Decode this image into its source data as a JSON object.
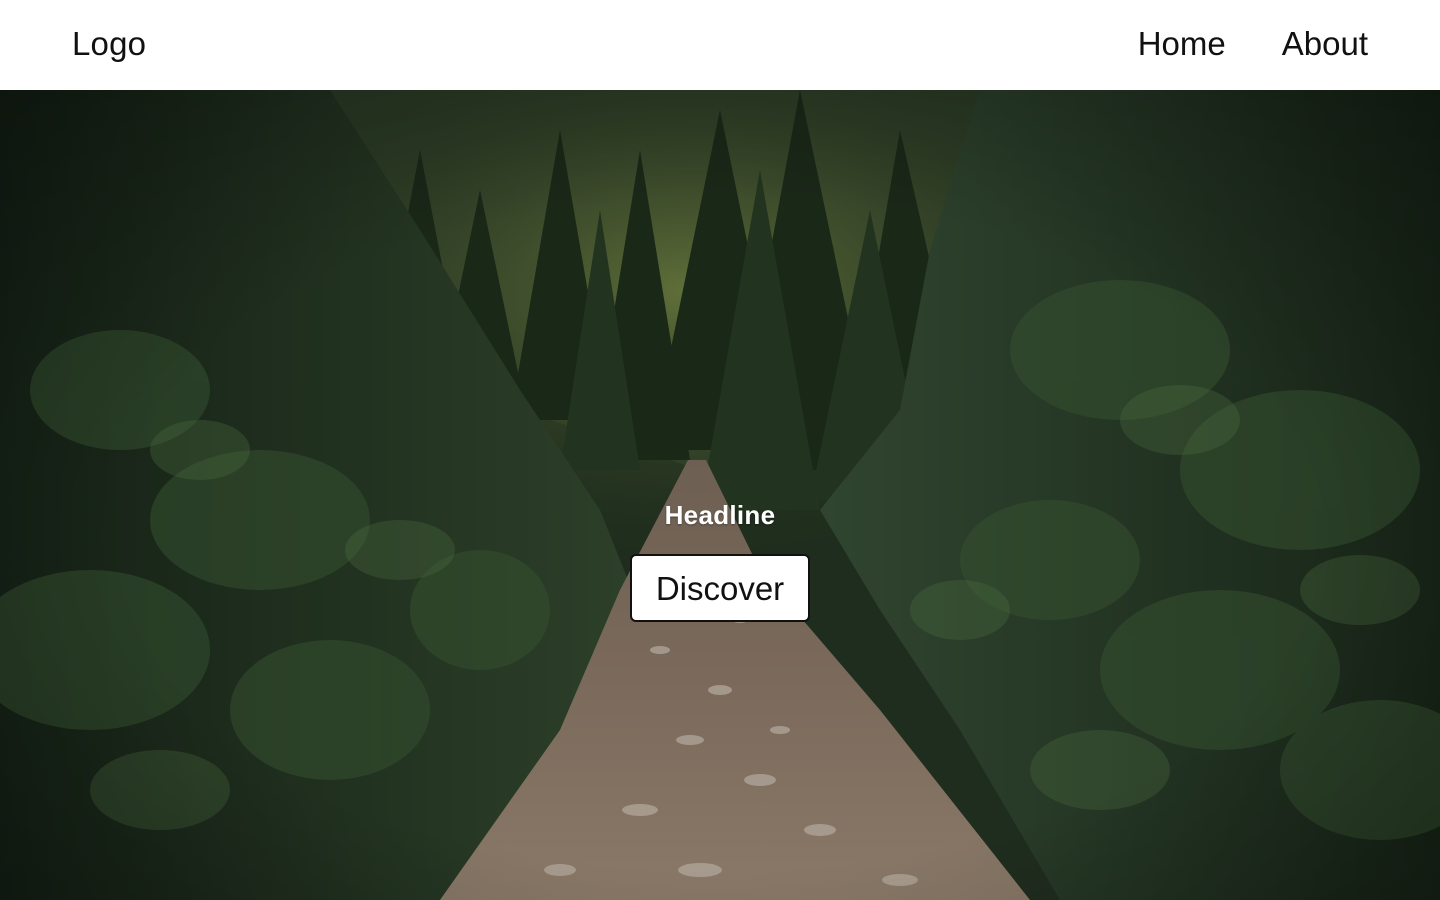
{
  "header": {
    "logo_label": "Logo",
    "nav": [
      {
        "label": "Home"
      },
      {
        "label": "About"
      }
    ]
  },
  "hero": {
    "headline": "Headline",
    "cta_label": "Discover",
    "background_image": "forest-trail-photo",
    "colors": {
      "headline": "#ffffff",
      "button_bg": "#ffffff",
      "button_text": "#111111",
      "header_bg": "#ffffff"
    }
  }
}
